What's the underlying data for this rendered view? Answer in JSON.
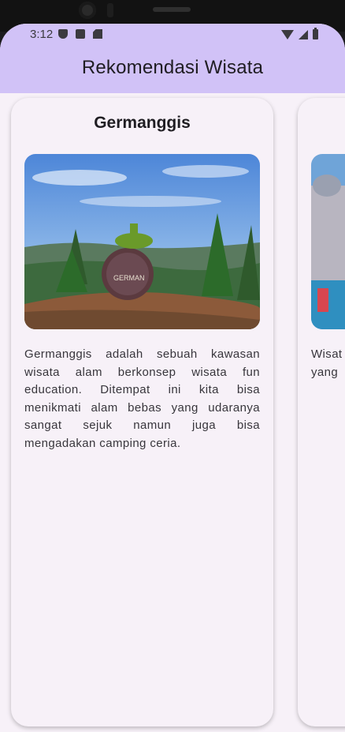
{
  "status_bar": {
    "time": "3:12",
    "icons_left": [
      "shield-icon",
      "a-icon",
      "sd-card-icon"
    ],
    "icons_right": [
      "wifi-icon",
      "signal-icon",
      "battery-icon"
    ]
  },
  "app_bar": {
    "title": "Rekomendasi Wisata",
    "color": "#d1c2f7"
  },
  "cards": [
    {
      "title": "Germanggis",
      "image": "mangosteen-statue-photo",
      "description": "Germanggis adalah sebuah kawasan wisata alam berkonsep wisata fun education. Ditempat ini kita bisa menikmati alam bebas yang udaranya sangat sejuk namun juga bisa mengadakan camping ceria."
    },
    {
      "title": "",
      "image": "mosque-park-photo",
      "description": "Wisat\nyang"
    }
  ]
}
